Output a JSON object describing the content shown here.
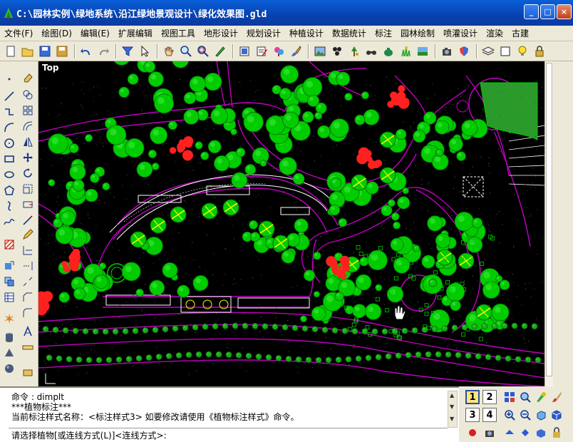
{
  "window": {
    "title": "C:\\园林实例\\绿地系统\\沿江绿地景观设计\\绿化效果图.gld",
    "buttons": {
      "minimize": "_",
      "maximize": "□",
      "close": "×"
    }
  },
  "menu": {
    "items": [
      "文件(F)",
      "绘图(D)",
      "编辑(E)",
      "扩展编辑",
      "视图工具",
      "地形设计",
      "规划设计",
      "种植设计",
      "数据统计",
      "标注",
      "园林绘制",
      "喷灌设计",
      "渲染",
      "古建"
    ]
  },
  "toolbar": {
    "icons": [
      "new-icon",
      "open-icon",
      "save-icon",
      "save-as-icon",
      "undo-icon",
      "redo-icon",
      "filter-icon",
      "select-icon",
      "pan-hand-icon",
      "zoom-realtime-icon",
      "zoom-window-icon",
      "zoom-extents-icon",
      "paint-icon",
      "edit-icon",
      "tree-brush-icon",
      "brush-icon",
      "picture-icon",
      "plant-icon",
      "tree-icon",
      "binoculars-icon",
      "teapot-icon",
      "grass-icon",
      "landscape-icon",
      "camera-icon",
      "shield-icon",
      "layers-icon",
      "color-icon",
      "bulb-icon",
      "lock-icon"
    ]
  },
  "canvas": {
    "view_label": "Top",
    "colors": {
      "background": "#000000",
      "path": "#c000c0",
      "tree": "#00cc00",
      "accent_red": "#ff2020",
      "accent_yellow": "#ffff00",
      "white": "#ffffff"
    }
  },
  "command": {
    "lines": [
      "命令 : dimplt",
      "***植物标注***",
      "当前标注样式名称：<标注样式3> 如要修改请使用《植物标注样式》命令。"
    ],
    "prompt": "请选择植物[或连线方式(L)]<连线方式>:"
  },
  "bottom_tools": {
    "view_buttons": [
      "1",
      "2",
      "3",
      "4"
    ]
  }
}
